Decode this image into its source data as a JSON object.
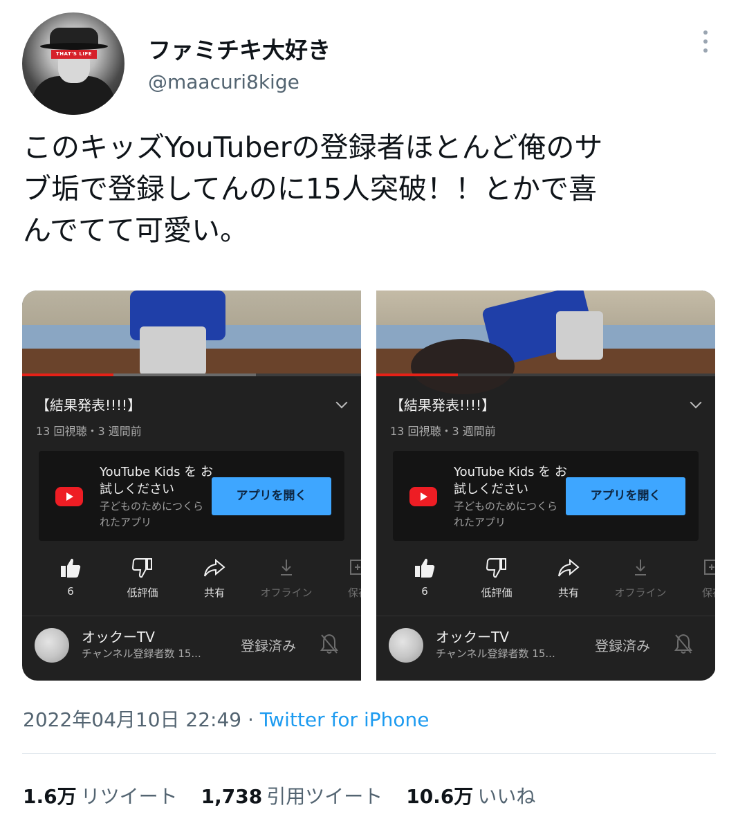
{
  "user": {
    "display_name": "ファミチキ大好き",
    "handle": "@maacuri8kige",
    "avatar_badge_text": "THAT'S LIFE"
  },
  "tweet": {
    "text": "このキッズYouTuberの登録者ほとんど俺のサ\nブ垢で登録してんのに15人突破！！とかで喜\nんでてて可愛い。",
    "timestamp": "2022年04月10日 22:49",
    "separator": " · ",
    "source": "Twitter for iPhone"
  },
  "screenshots": [
    {
      "video_title": "【結果発表!!!!】",
      "meta": "13 回視聴・3 週間前",
      "progress_played": 0.27,
      "progress_buffered": 0.69,
      "kids_promo": {
        "title": "YouTube Kids を お試しください",
        "subtitle": "子どものためにつくられたアプリ",
        "button": "アプリを開く"
      },
      "actions": [
        {
          "icon": "thumbs-up-icon",
          "label": "6"
        },
        {
          "icon": "thumbs-down-icon",
          "label": "低評価"
        },
        {
          "icon": "share-icon",
          "label": "共有"
        },
        {
          "icon": "download-icon",
          "label": "オフライン"
        },
        {
          "icon": "save-icon",
          "label": "保存"
        }
      ],
      "channel": {
        "name": "オックーTV",
        "subs": "チャンネル登録者数 15...",
        "subscribed_label": "登録済み"
      }
    },
    {
      "video_title": "【結果発表!!!!】",
      "meta": "13 回視聴・3 週間前",
      "progress_played": 0.24,
      "progress_buffered": 0.24,
      "kids_promo": {
        "title": "YouTube Kids を お試しください",
        "subtitle": "子どものためにつくられたアプリ",
        "button": "アプリを開く"
      },
      "actions": [
        {
          "icon": "thumbs-up-icon",
          "label": "6"
        },
        {
          "icon": "thumbs-down-icon",
          "label": "低評価"
        },
        {
          "icon": "share-icon",
          "label": "共有"
        },
        {
          "icon": "download-icon",
          "label": "オフライン"
        },
        {
          "icon": "save-icon",
          "label": "保存"
        }
      ],
      "channel": {
        "name": "オックーTV",
        "subs": "チャンネル登録者数 15...",
        "subscribed_label": "登録済み"
      }
    }
  ],
  "stats": {
    "retweets_count": "1.6万",
    "retweets_label": "リツイート",
    "quotes_count": "1,738",
    "quotes_label": "引用ツイート",
    "likes_count": "10.6万",
    "likes_label": "いいね"
  },
  "colors": {
    "link": "#1d9bf0",
    "secondary_text": "#536471",
    "yt_dark_bg": "#212121",
    "yt_red": "#e62117",
    "yt_button_blue": "#3ea6ff"
  }
}
